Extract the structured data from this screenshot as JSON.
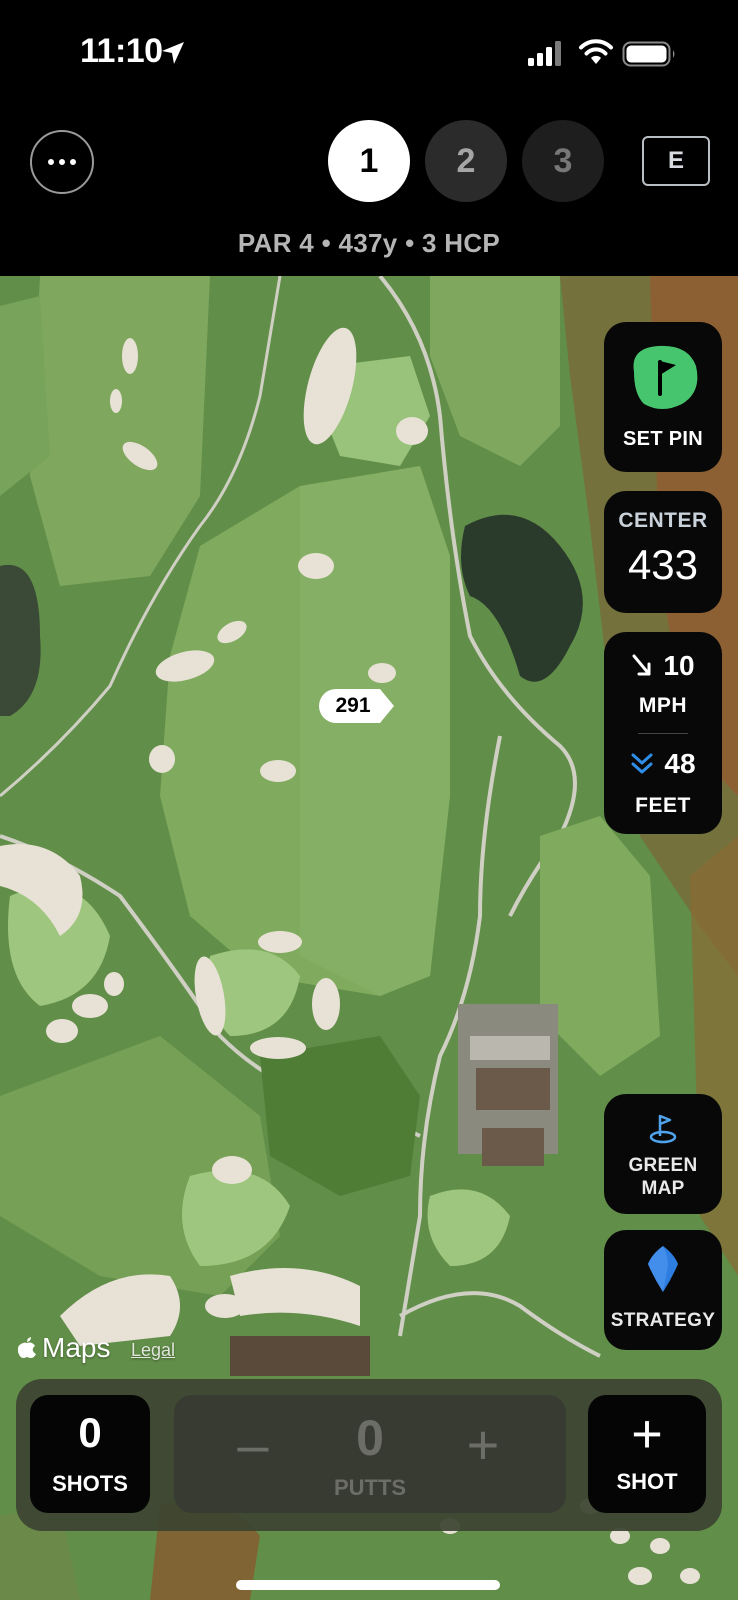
{
  "status_bar": {
    "time": "11:10"
  },
  "header": {
    "menu_icon": "ellipsis-icon",
    "holes": [
      "1",
      "2",
      "3"
    ],
    "selected_hole": "1",
    "tee_label": "E",
    "hole_info": "PAR 4 • 437y • 3 HCP"
  },
  "map": {
    "distance_marker": "291",
    "attribution": "Maps",
    "legal": "Legal"
  },
  "panels": {
    "set_pin": {
      "label": "SET PIN",
      "icon": "flag-icon",
      "accent": "#47c56e"
    },
    "center": {
      "label": "CENTER",
      "value": "433"
    },
    "wind": {
      "speed": "10",
      "speed_unit": "MPH",
      "elevation": "48",
      "elevation_unit": "FEET",
      "accent": "#2f8fe8"
    },
    "green_map": {
      "label_line1": "GREEN",
      "label_line2": "MAP",
      "icon": "green-map-icon"
    },
    "strategy": {
      "label": "STRATEGY",
      "icon": "gem-icon",
      "accent": "#2e7de0"
    }
  },
  "bottom": {
    "shots_count": "0",
    "shots_label": "SHOTS",
    "putts_count": "0",
    "putts_label": "PUTTS",
    "minus": "–",
    "plus": "+",
    "add_shot_plus": "+",
    "add_shot_label": "SHOT"
  }
}
